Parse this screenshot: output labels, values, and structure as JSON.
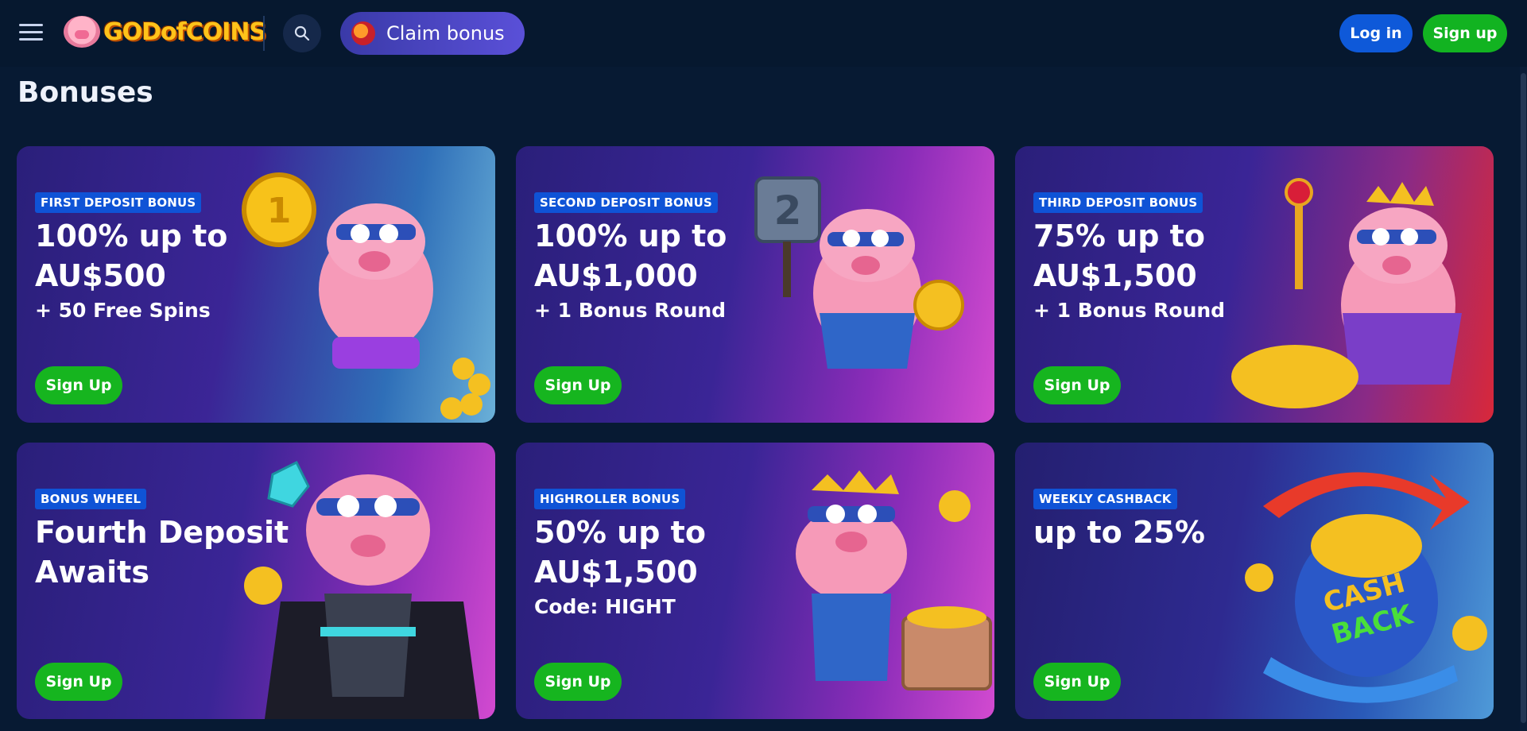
{
  "header": {
    "logo_text": "GODofCOINS",
    "claim_label": "Claim bonus",
    "login_label": "Log in",
    "signup_label": "Sign up"
  },
  "page": {
    "title": "Bonuses"
  },
  "cards": [
    {
      "badge": "FIRST DEPOSIT BONUS",
      "headline": "100% up to AU$500",
      "sub": "+ 50 Free Spins",
      "cta": "Sign Up"
    },
    {
      "badge": "SECOND DEPOSIT BONUS",
      "headline": "100% up to AU$1,000",
      "sub": "+ 1 Bonus Round",
      "cta": "Sign Up"
    },
    {
      "badge": "THIRD DEPOSIT BONUS",
      "headline": "75% up to AU$1,500",
      "sub": "+ 1 Bonus Round",
      "cta": "Sign Up"
    },
    {
      "badge": "BONUS WHEEL",
      "headline": "Fourth Deposit Awaits",
      "sub": "",
      "cta": "Sign Up"
    },
    {
      "badge": "HIGHROLLER BONUS",
      "headline": "50% up to AU$1,500",
      "sub": "Code: HIGHT",
      "cta": "Sign Up"
    },
    {
      "badge": "WEEKLY CASHBACK",
      "headline": "up to 25%",
      "sub": "",
      "cta": "Sign Up"
    }
  ],
  "colors": {
    "background": "#071a33",
    "login_button": "#0e59d9",
    "signup_button": "#12b321",
    "badge": "#0f53d6"
  }
}
